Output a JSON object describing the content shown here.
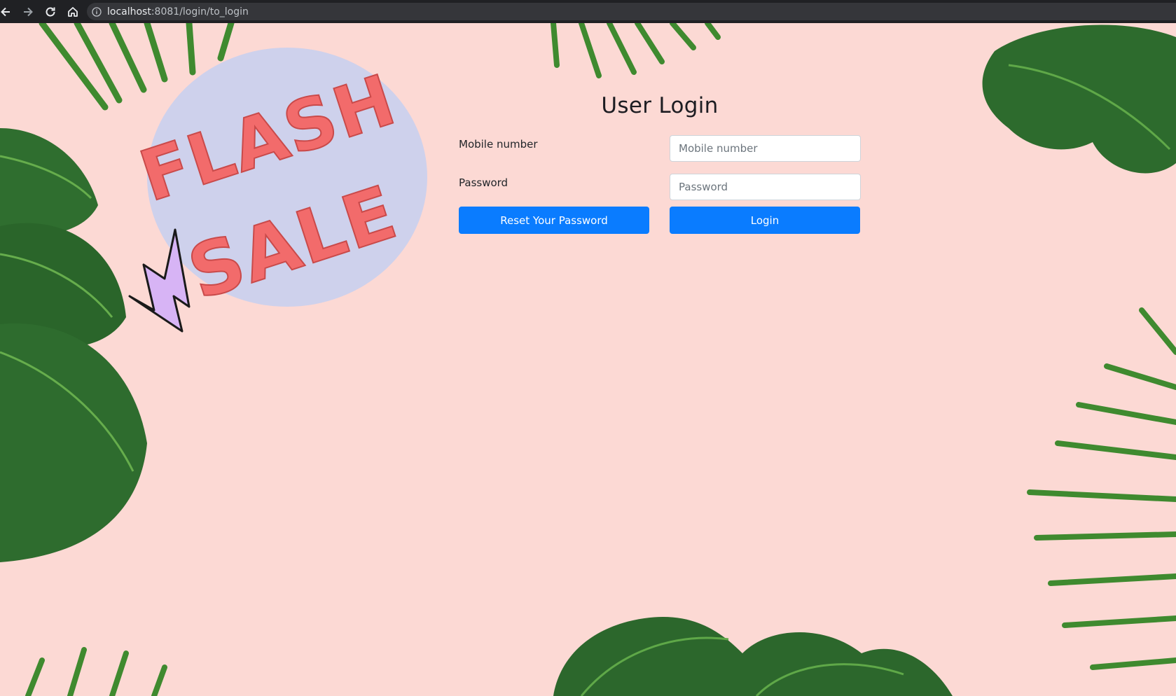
{
  "browser": {
    "url_host": "localhost",
    "url_rest": ":8081/login/to_login"
  },
  "banner": {
    "line1": "FLASH",
    "line2": "SALE"
  },
  "login": {
    "title": "User Login",
    "mobile_label": "Mobile number",
    "mobile_placeholder": "Mobile number",
    "mobile_value": "",
    "password_label": "Password",
    "password_placeholder": "Password",
    "password_value": "",
    "reset_label": "Reset Your Password",
    "login_label": "Login"
  },
  "colors": {
    "background": "#fcd9d4",
    "button": "#0a7cff",
    "leaf": "#2f6b2f",
    "banner_text": "#f26b6b",
    "banner_blob": "#c9cfee"
  }
}
